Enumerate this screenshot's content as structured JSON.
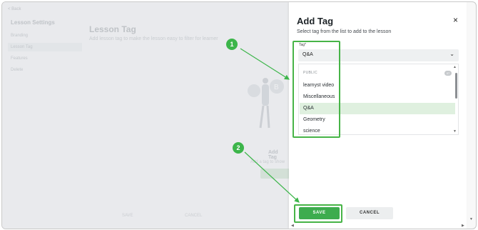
{
  "background": {
    "back_link": "< Back",
    "sidebar_title": "Lesson Settings",
    "sidebar_items": [
      "Branding",
      "Lesson Tag",
      "Features",
      "Delete"
    ],
    "title": "Lesson Tag",
    "subtitle": "Add lesson tag to make the lesson easy to filter for learner",
    "empty_title": "Add Tag",
    "empty_sub": "Add a tag to show",
    "footer_save": "SAVE",
    "footer_cancel": "CANCEL"
  },
  "drawer": {
    "title": "Add Tag",
    "close_label": "×",
    "subtitle": "Select tag from the list to add to the lesson",
    "field_label": "Tag*",
    "selected_value": "Q&A",
    "group_label": "PUBLIC",
    "group_count": "07",
    "options": [
      "learnyst video",
      "Miscellaneous",
      "Q&A",
      "Geometry",
      "science"
    ],
    "selected_index": 2,
    "save_label": "SAVE",
    "cancel_label": "CANCEL"
  },
  "callouts": [
    "1",
    "2"
  ],
  "colors": {
    "accent_green": "#3dac4e",
    "callout_green": "#3cb54a",
    "selected_row": "#dff0df"
  },
  "icons": {
    "close": "close-icon",
    "dropdown": "chevron-down-icon"
  }
}
